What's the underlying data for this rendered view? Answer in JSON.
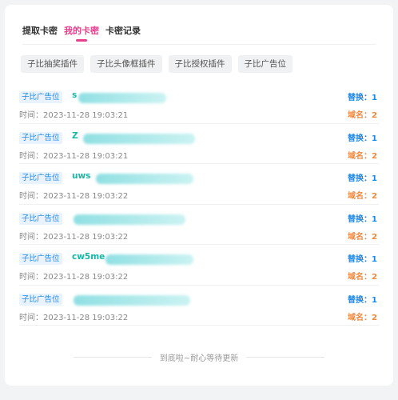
{
  "tabs": [
    {
      "label": "提取卡密",
      "active": false
    },
    {
      "label": "我的卡密",
      "active": true
    },
    {
      "label": "卡密记录",
      "active": false
    }
  ],
  "filters": [
    "子比抽奖插件",
    "子比头像框插件",
    "子比授权插件",
    "子比广告位"
  ],
  "records": [
    {
      "tag": "子比广告位",
      "code_visible": "s",
      "time": "时间：2023-11-28 19:03:21",
      "replace": "替换：1",
      "domain": "域名：2"
    },
    {
      "tag": "子比广告位",
      "code_visible": "Z",
      "time": "时间：2023-11-28 19:03:21",
      "replace": "替换：1",
      "domain": "域名：2"
    },
    {
      "tag": "子比广告位",
      "code_visible": "uws",
      "time": "时间：2023-11-28 19:03:22",
      "replace": "替换：1",
      "domain": "域名：2"
    },
    {
      "tag": "子比广告位",
      "code_visible": "",
      "time": "时间：2023-11-28 19:03:22",
      "replace": "替换：1",
      "domain": "域名：2"
    },
    {
      "tag": "子比广告位",
      "code_visible": "cw5me",
      "time": "时间：2023-11-28 19:03:22",
      "replace": "替换：1",
      "domain": "域名：2"
    },
    {
      "tag": "子比广告位",
      "code_visible": "",
      "time": "时间：2023-11-28 19:03:22",
      "replace": "替换：1",
      "domain": "域名：2"
    }
  ],
  "footer": {
    "text": "到底啦~耐心等待更新"
  },
  "colors": {
    "accent": "#e83e8c",
    "badge_text": "#1e88e5",
    "badge_bg": "#e8f3ff",
    "code": "#14b8a6",
    "replace": "#1e88e5",
    "domain": "#f0883e"
  }
}
